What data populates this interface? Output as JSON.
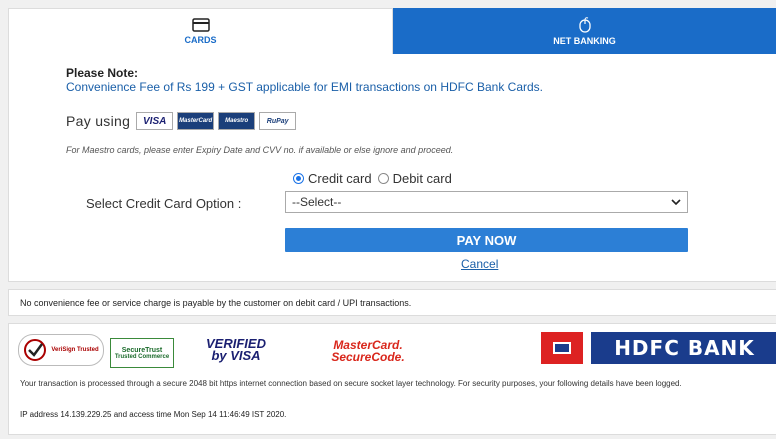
{
  "tabs": [
    {
      "label": "CARDS",
      "icon": "credit-card-icon",
      "active": true
    },
    {
      "label": "NET BANKING",
      "icon": "mouse-icon",
      "active": false
    }
  ],
  "note": {
    "title": "Please Note:",
    "text": "Convenience Fee of Rs 199 + GST applicable for EMI transactions on HDFC Bank Cards."
  },
  "pay_using": {
    "label": "Pay using",
    "logos": [
      "VISA",
      "MasterCard",
      "Maestro",
      "RuPay"
    ]
  },
  "maestro_note": "For Maestro cards, please enter Expiry Date and CVV no. if available or else ignore and proceed.",
  "card_type": {
    "options": [
      "Credit card",
      "Debit card"
    ],
    "selected": "Credit card"
  },
  "select_option": {
    "label": "Select Credit Card Option :",
    "value": "--Select--"
  },
  "pay_now_label": "PAY NOW",
  "cancel_label": "Cancel",
  "fee_note": "No convenience fee or service charge is payable by the customer on debit card / UPI transactions.",
  "secure_logos": {
    "verisign": "VeriSign Trusted",
    "securetrust_1": "SecureTrust",
    "securetrust_2": "Trusted Commerce",
    "verified_1": "VERIFIED",
    "verified_2": "by VISA",
    "mc_1": "MasterCard.",
    "mc_2": "SecureCode.",
    "bank": "HDFC BANK"
  },
  "secure_text": "Your transaction is processed through a secure 2048 bit https internet connection based on secure socket layer technology. For security purposes, your following details have been logged.",
  "ip_text": "IP address 14.139.229.25 and access time Mon Sep 14 11:46:49 IST 2020.",
  "colors": {
    "accent": "#1a6cc8",
    "button": "#2c7fd6",
    "link": "#1a5fa8"
  }
}
